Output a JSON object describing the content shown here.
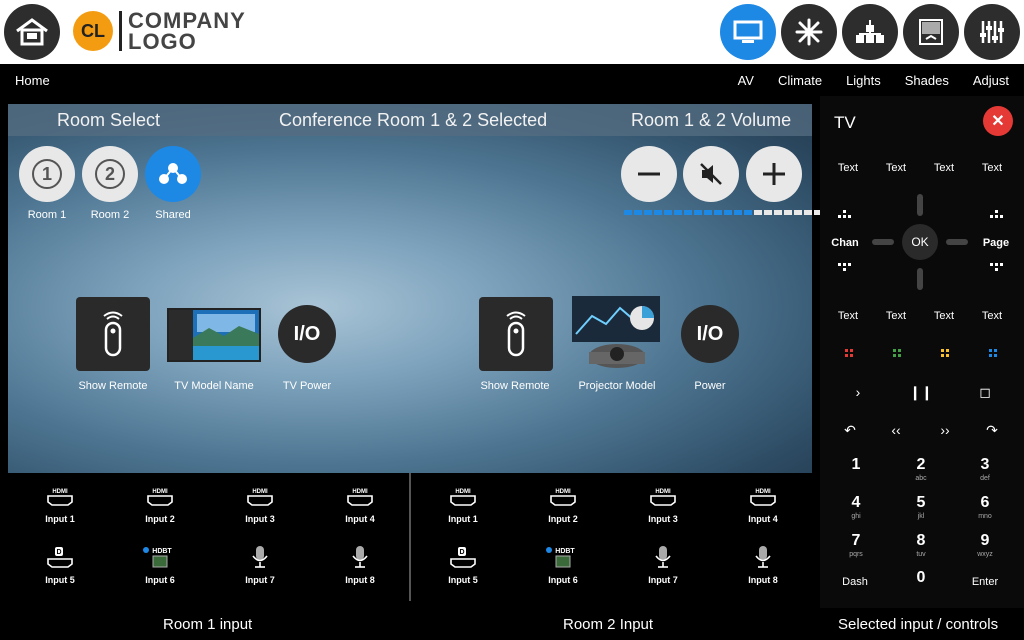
{
  "header": {
    "logo_initials": "CL",
    "logo_line1": "COMPANY",
    "logo_line2": "LOGO",
    "icons": [
      "home-icon",
      "display-icon",
      "snowflake-icon",
      "chandelier-icon",
      "shades-icon",
      "sliders-icon"
    ]
  },
  "nav": {
    "home": "Home",
    "items": [
      "AV",
      "Climate",
      "Lights",
      "Shades",
      "Adjust"
    ]
  },
  "scene": {
    "room_select": "Room Select",
    "status": "Conference Room 1 & 2 Selected",
    "volume_title": "Room 1 & 2 Volume",
    "rooms": [
      {
        "num": "1",
        "label": "Room 1"
      },
      {
        "num": "2",
        "label": "Room 2"
      },
      {
        "label": "Shared"
      }
    ],
    "volume_level": 0.65,
    "room1_devices": {
      "remote": "Show Remote",
      "display": "TV Model Name",
      "power": "TV Power",
      "power_glyph": "I/O"
    },
    "room2_devices": {
      "remote": "Show Remote",
      "display": "Projector Model",
      "power": "Power",
      "power_glyph": "I/O"
    }
  },
  "inputs": {
    "room1": [
      "Input 1",
      "Input 2",
      "Input 3",
      "Input 4",
      "Input 5",
      "Input 6",
      "Input 7",
      "Input 8"
    ],
    "room2": [
      "Input 1",
      "Input 2",
      "Input 3",
      "Input 4",
      "Input 5",
      "Input 6",
      "Input 7",
      "Input 8"
    ],
    "hdmi": "HDMI",
    "hdbt": "HDBT"
  },
  "bottom": {
    "room1": "Room 1 input",
    "room2": "Room 2 Input",
    "right": "Selected input / controls"
  },
  "panel": {
    "title": "TV",
    "text_row1": [
      "Text",
      "Text",
      "Text",
      "Text"
    ],
    "chan": "Chan",
    "page": "Page",
    "ok": "OK",
    "text_row2": [
      "Text",
      "Text",
      "Text",
      "Text"
    ],
    "color_keys": [
      "#e53935",
      "#43a047",
      "#fbc02d",
      "#1e88e5"
    ],
    "transport1": [
      "›",
      "❙❙",
      "◻"
    ],
    "transport2": [
      "↶",
      "‹‹",
      "››",
      "↷"
    ],
    "keys": [
      {
        "n": "1",
        "s": ""
      },
      {
        "n": "2",
        "s": "abc"
      },
      {
        "n": "3",
        "s": "def"
      },
      {
        "n": "4",
        "s": "ghi"
      },
      {
        "n": "5",
        "s": "jkl"
      },
      {
        "n": "6",
        "s": "mno"
      },
      {
        "n": "7",
        "s": "pqrs"
      },
      {
        "n": "8",
        "s": "tuv"
      },
      {
        "n": "9",
        "s": "wxyz"
      }
    ],
    "dash": "Dash",
    "zero": "0",
    "enter": "Enter"
  }
}
